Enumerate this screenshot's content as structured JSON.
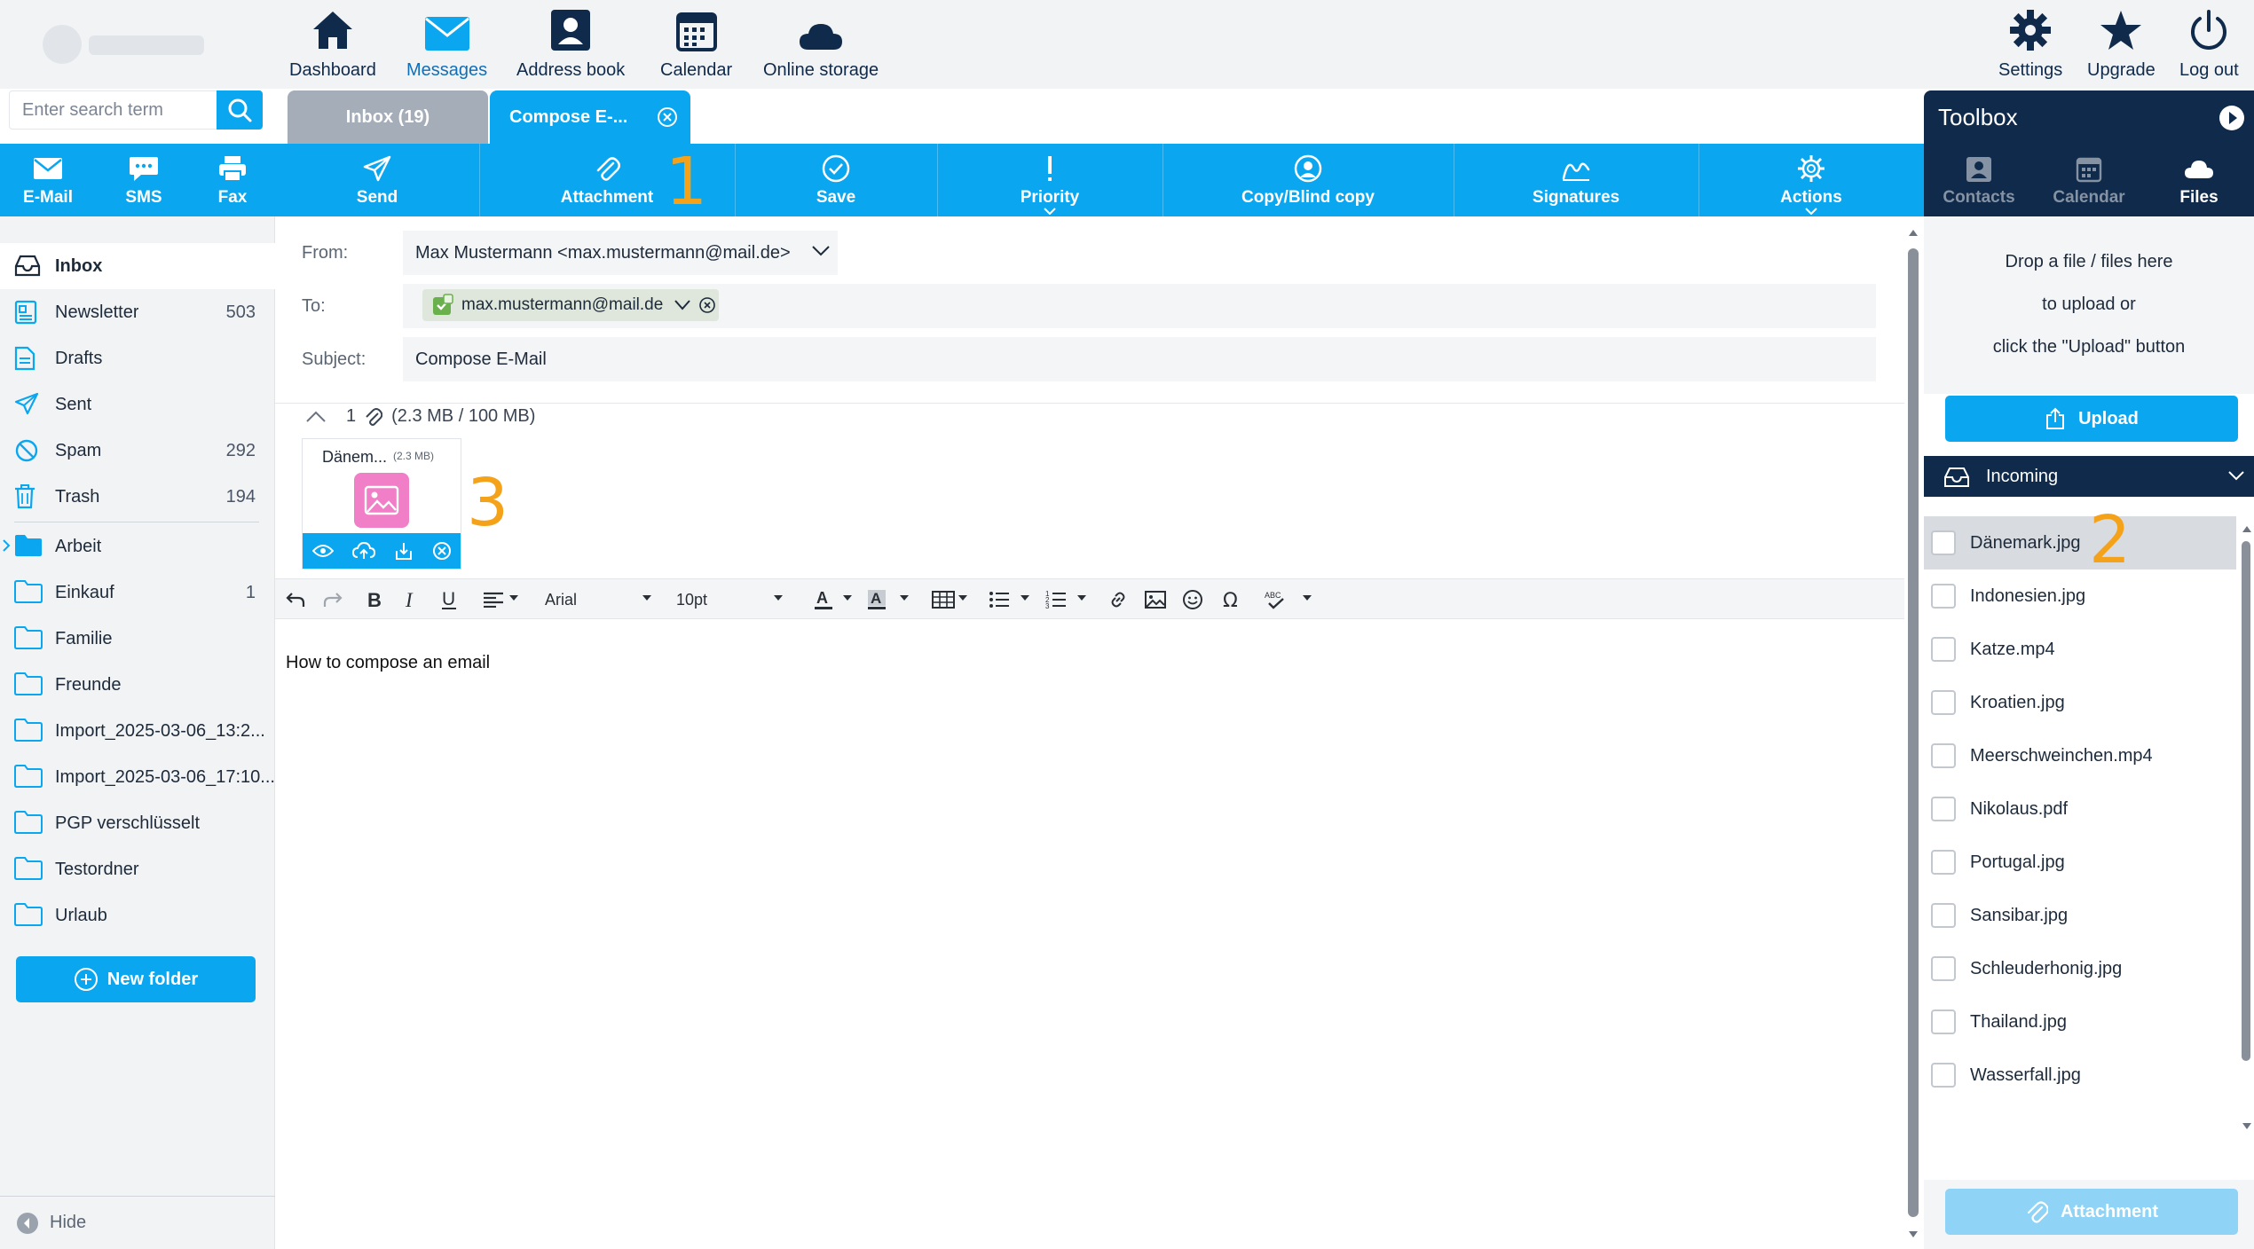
{
  "nav": {
    "items": [
      {
        "label": "Dashboard",
        "icon": "home-icon"
      },
      {
        "label": "Messages",
        "icon": "envelope-icon"
      },
      {
        "label": "Address book",
        "icon": "contact-card-icon"
      },
      {
        "label": "Calendar",
        "icon": "calendar-icon"
      },
      {
        "label": "Online storage",
        "icon": "cloud-icon"
      }
    ],
    "right": [
      {
        "label": "Settings",
        "icon": "gear-icon"
      },
      {
        "label": "Upgrade",
        "icon": "star-icon"
      },
      {
        "label": "Log out",
        "icon": "power-icon"
      }
    ]
  },
  "search": {
    "placeholder": "Enter search term"
  },
  "tabs": {
    "inbox": "Inbox (19)",
    "compose": "Compose E-..."
  },
  "create": {
    "email": "E-Mail",
    "sms": "SMS",
    "fax": "Fax"
  },
  "actions": {
    "send": "Send",
    "attachment": "Attachment",
    "save": "Save",
    "priority": "Priority",
    "copy": "Copy/Blind copy",
    "signatures": "Signatures",
    "more": "Actions"
  },
  "markers": {
    "one": "1",
    "two": "2",
    "three": "3"
  },
  "folders": [
    {
      "label": "Inbox",
      "count": "",
      "icon": "inbox-icon"
    },
    {
      "label": "Newsletter",
      "count": "503",
      "icon": "newsletter-icon"
    },
    {
      "label": "Drafts",
      "count": "",
      "icon": "drafts-icon"
    },
    {
      "label": "Sent",
      "count": "",
      "icon": "send-icon"
    },
    {
      "label": "Spam",
      "count": "292",
      "icon": "spam-icon"
    },
    {
      "label": "Trash",
      "count": "194",
      "icon": "trash-icon"
    }
  ],
  "custom_folders": [
    {
      "label": "Arbeit",
      "count": ""
    },
    {
      "label": "Einkauf",
      "count": "1"
    },
    {
      "label": "Familie",
      "count": ""
    },
    {
      "label": "Freunde",
      "count": ""
    },
    {
      "label": "Import_2025-03-06_13:2...",
      "count": ""
    },
    {
      "label": "Import_2025-03-06_17:10...",
      "count": ""
    },
    {
      "label": "PGP verschlüsselt",
      "count": ""
    },
    {
      "label": "Testordner",
      "count": ""
    },
    {
      "label": "Urlaub",
      "count": ""
    }
  ],
  "sidebar": {
    "new_folder": "New folder",
    "hide": "Hide"
  },
  "compose": {
    "from_label": "From:",
    "from_value": "Max Mustermann <max.mustermann@mail.de>",
    "to_label": "To:",
    "to_chip": "max.mustermann@mail.de",
    "subject_label": "Subject:",
    "subject_value": "Compose E-Mail",
    "attach_count": "1",
    "attach_size": "(2.3 MB / 100 MB)",
    "attach_file": "Dänem...",
    "attach_file_size": "(2.3 MB)",
    "body": "How to compose an email"
  },
  "editor": {
    "font": "Arial",
    "size": "10pt"
  },
  "toolbox": {
    "title": "Toolbox",
    "tabs": {
      "contacts": "Contacts",
      "calendar": "Calendar",
      "files": "Files"
    },
    "drop_line1": "Drop a file / files here",
    "drop_line2": "to upload or",
    "drop_line3": "click the \"Upload\" button",
    "upload": "Upload",
    "folder": "Incoming",
    "files": [
      "Dänemark.jpg",
      "Indonesien.jpg",
      "Katze.mp4",
      "Kroatien.jpg",
      "Meerschweinchen.mp4",
      "Nikolaus.pdf",
      "Portugal.jpg",
      "Sansibar.jpg",
      "Schleuderhonig.jpg",
      "Thailand.jpg",
      "Wasserfall.jpg"
    ],
    "attach_button": "Attachment"
  },
  "colors": {
    "accent": "#0aa7f0",
    "navy": "#0f2a4a",
    "marker": "#f5a21b"
  }
}
